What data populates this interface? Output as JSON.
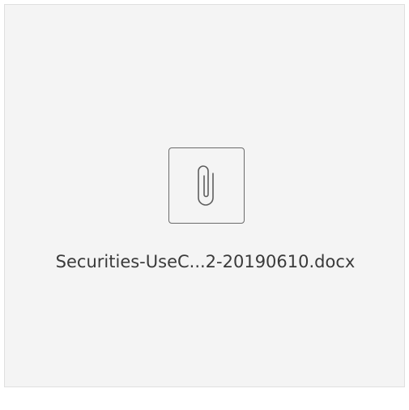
{
  "attachment": {
    "icon": "paperclip-icon",
    "filename": "Securities-UseC...2-20190610.docx"
  }
}
